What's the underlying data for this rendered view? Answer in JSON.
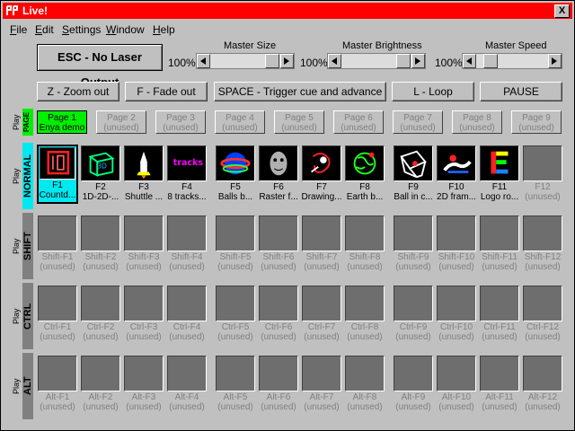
{
  "window": {
    "title": "Live!",
    "close_label": "X"
  },
  "menu": [
    {
      "label": "File",
      "accel": "F"
    },
    {
      "label": "Edit",
      "accel": "E"
    },
    {
      "label": "Settings",
      "accel": "S"
    },
    {
      "label": "Window",
      "accel": "W"
    },
    {
      "label": "Help",
      "accel": "H"
    }
  ],
  "esc_button": "ESC - No Laser Output",
  "sliders": [
    {
      "label": "Master Size",
      "value_text": "100%",
      "value": 1.0
    },
    {
      "label": "Master Brightness",
      "value_text": "100%",
      "value": 1.0
    },
    {
      "label": "Master Speed",
      "value_text": "100%",
      "value": 0.0
    }
  ],
  "function_buttons": [
    "Z - Zoom out",
    "F - Fade out",
    "SPACE - Trigger cue and advance",
    "L - Loop",
    "PAUSE"
  ],
  "rows": {
    "page": {
      "play": "Play",
      "mode": "PAGE",
      "color": "#00ee00"
    },
    "normal": {
      "play": "Play",
      "mode": "NORMAL",
      "color": "#00e8f0"
    },
    "shift": {
      "play": "Play",
      "mode": "SHIFT",
      "color": "#808080"
    },
    "ctrl": {
      "play": "Play",
      "mode": "CTRL",
      "color": "#808080"
    },
    "alt": {
      "play": "Play",
      "mode": "ALT",
      "color": "#808080"
    }
  },
  "pages": [
    {
      "line1": "Page 1",
      "line2": "Enya demo"
    },
    {
      "line1": "Page 2",
      "line2": "(unused)"
    },
    {
      "line1": "Page 3",
      "line2": "(unused)"
    },
    {
      "line1": "Page 4",
      "line2": "(unused)"
    },
    {
      "line1": "Page 5",
      "line2": "(unused)"
    },
    {
      "line1": "Page 6",
      "line2": "(unused)"
    },
    {
      "line1": "Page 7",
      "line2": "(unused)"
    },
    {
      "line1": "Page 8",
      "line2": "(unused)"
    },
    {
      "line1": "Page 9",
      "line2": "(unused)"
    }
  ],
  "normal_cues": [
    {
      "key": "F1",
      "name": "Countd..."
    },
    {
      "key": "F2",
      "name": "1D-2D-..."
    },
    {
      "key": "F3",
      "name": "Shuttle ..."
    },
    {
      "key": "F4",
      "name": "8 tracks..."
    },
    {
      "key": "F5",
      "name": "Balls b..."
    },
    {
      "key": "F6",
      "name": "Raster f..."
    },
    {
      "key": "F7",
      "name": "Drawing..."
    },
    {
      "key": "F8",
      "name": "Earth b..."
    },
    {
      "key": "F9",
      "name": "Ball in c..."
    },
    {
      "key": "F10",
      "name": "2D fram..."
    },
    {
      "key": "F11",
      "name": "Logo ro..."
    },
    {
      "key": "F12",
      "name": "(unused)"
    }
  ],
  "thumb_icons": [
    "countdown-icon",
    "cube-icon",
    "shuttle-icon",
    "tracks-text-icon",
    "balls-icon",
    "raster-face-icon",
    "drawing-icon",
    "earth-icon",
    "ball-in-cube-icon",
    "2d-frame-icon",
    "logo-icon",
    ""
  ],
  "unused_text": "(unused)",
  "shift_keys": [
    "Shift-F1",
    "Shift-F2",
    "Shift-F3",
    "Shift-F4",
    "Shift-F5",
    "Shift-F6",
    "Shift-F7",
    "Shift-F8",
    "Shift-F9",
    "Shift-F10",
    "Shift-F11",
    "Shift-F12"
  ],
  "ctrl_keys": [
    "Ctrl-F1",
    "Ctrl-F2",
    "Ctrl-F3",
    "Ctrl-F4",
    "Ctrl-F5",
    "Ctrl-F6",
    "Ctrl-F7",
    "Ctrl-F8",
    "Ctrl-F9",
    "Ctrl-F10",
    "Ctrl-F11",
    "Ctrl-F12"
  ],
  "alt_keys": [
    "Alt-F1",
    "Alt-F2",
    "Alt-F3",
    "Alt-F4",
    "Alt-F5",
    "Alt-F6",
    "Alt-F7",
    "Alt-F8",
    "Alt-F9",
    "Alt-F10",
    "Alt-F11",
    "Alt-F12"
  ]
}
